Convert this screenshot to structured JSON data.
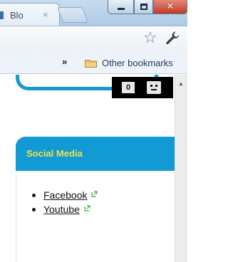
{
  "browser": {
    "tab": {
      "title": "Blo",
      "close_glyph": "×"
    },
    "window_controls": {
      "minimize": "minimize-icon",
      "maximize": "maximize-icon",
      "close": "✕"
    },
    "toolbar": {
      "bookmark_star": "☆",
      "wrench": "wrench-icon"
    },
    "bookmarks_bar": {
      "chevron": "»",
      "folder_label": "Other bookmarks"
    }
  },
  "page": {
    "counter": {
      "value": "0"
    },
    "widget": {
      "title": "Social Media",
      "links": [
        "Facebook",
        "Youtube"
      ]
    }
  },
  "colors": {
    "widget_blue": "#119ad3",
    "widget_title": "#f5e24a",
    "close_red": "#c23a22"
  }
}
